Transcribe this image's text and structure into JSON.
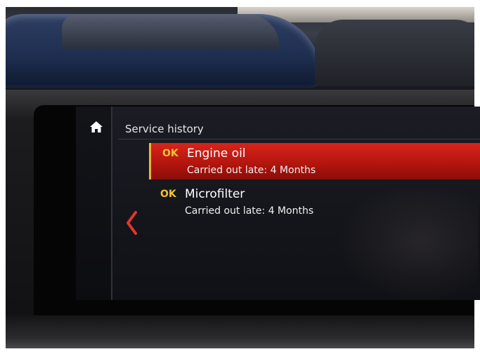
{
  "screen": {
    "title": "Service history",
    "items": [
      {
        "status": "OK",
        "name": "Engine oil",
        "detail": "Carried out late: 4 Months",
        "selected": true
      },
      {
        "status": "OK",
        "name": "Microfilter",
        "detail": "Carried out late: 4 Months",
        "selected": false
      }
    ]
  },
  "icons": {
    "home": "home-icon",
    "back": "chevron-left-icon"
  },
  "colors": {
    "selected_row": "#c41d14",
    "status_ok": "#f5c230",
    "back_chevron": "#e2362b"
  }
}
